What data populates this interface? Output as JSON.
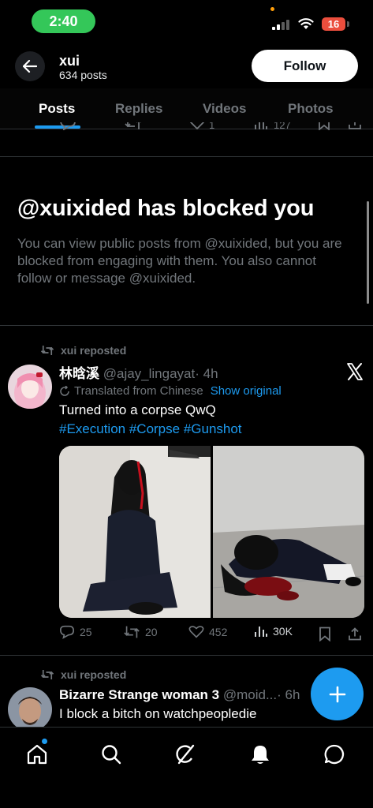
{
  "status_bar": {
    "time": "2:40",
    "battery": "16"
  },
  "header": {
    "name": "xui",
    "post_count": "634 posts",
    "follow_label": "Follow"
  },
  "tabs": [
    {
      "label": "Posts",
      "active": true
    },
    {
      "label": "Replies",
      "active": false
    },
    {
      "label": "Videos",
      "active": false
    },
    {
      "label": "Photos",
      "active": false
    }
  ],
  "previous_post": {
    "like_count": "1",
    "view_count": "127"
  },
  "blocked_notice": {
    "title": "@xuixided has blocked you",
    "description": "You can view public posts from @xuixided, but you are blocked from engaging with them. You also cannot follow or message @xuixided."
  },
  "tweets": [
    {
      "repost_label": "xui reposted",
      "display_name": "林晗溪",
      "handle": "@ajay_lingayat",
      "time": "· 4h",
      "translated_label": "Translated from Chinese",
      "show_original": "Show original",
      "text": "Turned into a corpse QwQ",
      "hashtags": "#Execution #Corpse #Gunshot",
      "stats": {
        "replies": "25",
        "reposts": "20",
        "likes": "452",
        "views": "30K"
      }
    },
    {
      "repost_label": "xui reposted",
      "display_name": "Bizarre Strange woman 3",
      "handle": "@moid...",
      "time": "· 6h",
      "text": "I block a bitch on watchpeopledie"
    }
  ],
  "colors": {
    "accent": "#1d9bf0",
    "background": "#000000",
    "secondary_text": "#71767b",
    "status_time_pill": "#34c759",
    "battery": "#eb4e3d"
  },
  "icons": {
    "back": "arrow-left-icon",
    "repost": "repost-icon",
    "translate": "translate-icon",
    "x_logo": "x-logo-icon",
    "reply": "reply-icon",
    "like": "heart-icon",
    "views": "views-icon",
    "bookmark": "bookmark-icon",
    "share": "share-icon",
    "compose": "plus-icon",
    "nav": [
      "home-icon",
      "search-icon",
      "grok-icon",
      "notifications-icon",
      "messages-icon"
    ]
  }
}
